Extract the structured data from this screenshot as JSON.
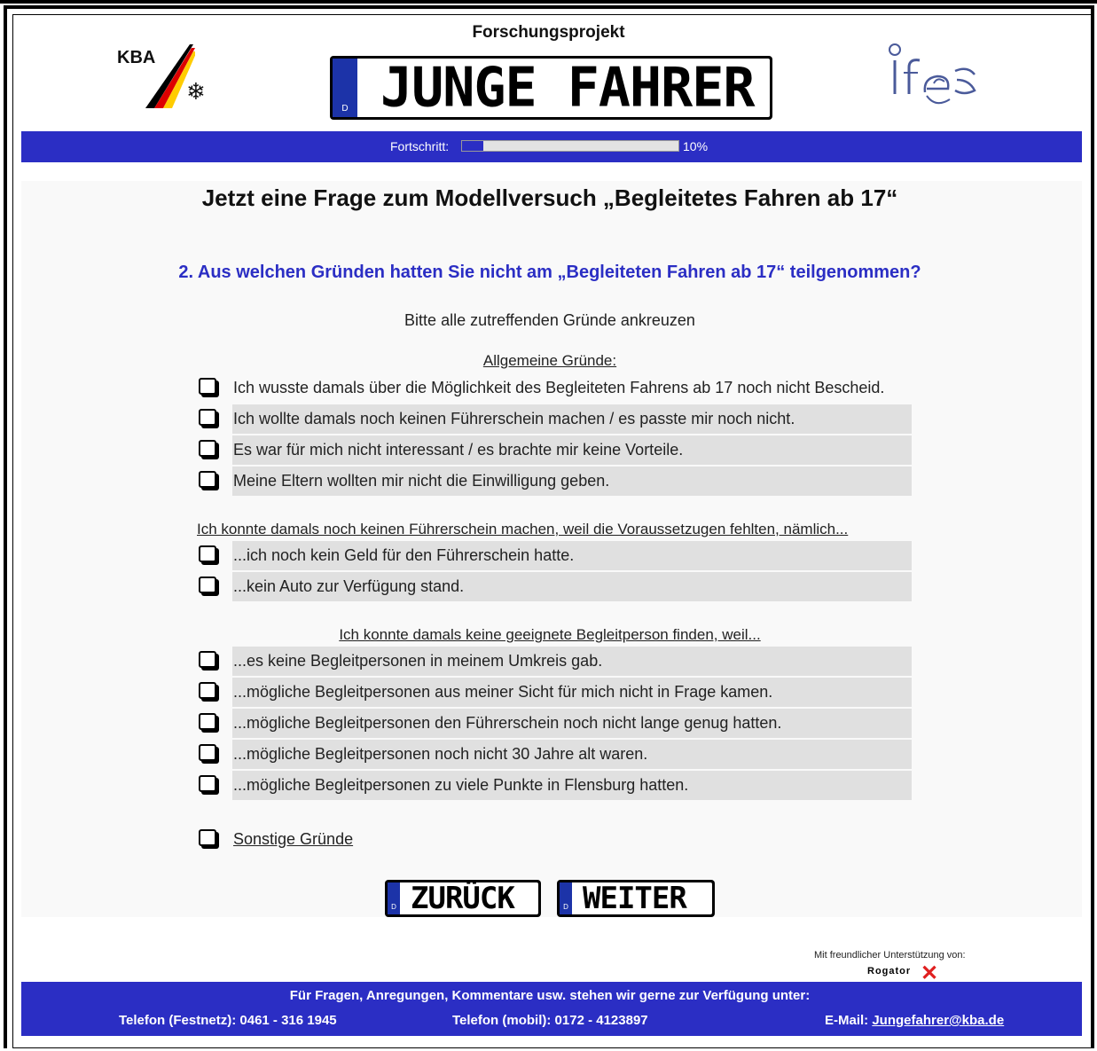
{
  "header": {
    "kba_label": "KBA",
    "project_title": "Forschungsprojekt",
    "plate_text": "JUNGE FAHRER",
    "plate_country": "D"
  },
  "progress": {
    "label": "Fortschritt:",
    "value_percent": 10,
    "value_text": "10%"
  },
  "main": {
    "headline": "Jetzt eine Frage zum Modellversuch „Begleitetes Fahren ab 17“",
    "question": "2. Aus welchen Gründen hatten Sie nicht am „Begleiteten Fahren ab 17“ teilgenommen?",
    "instruction": "Bitte alle zutreffenden Gründe ankreuzen",
    "sections": [
      {
        "title": "Allgemeine Gründe:",
        "options": [
          "Ich wusste damals über die Möglichkeit des Begleiteten Fahrens ab 17 noch nicht Bescheid.",
          "Ich wollte damals noch keinen Führerschein machen / es passte mir noch nicht.",
          "Es war für mich nicht interessant / es brachte mir keine Vorteile.",
          "Meine Eltern wollten mir nicht die Einwilligung geben."
        ]
      },
      {
        "title": "Ich konnte damals noch keinen Führerschein machen, weil die Voraussetzugen fehlten, nämlich...",
        "options": [
          "...ich noch kein Geld für den Führerschein hatte.",
          "...kein Auto zur Verfügung stand."
        ]
      },
      {
        "title": "Ich konnte damals keine geeignete Begleitperson finden, weil...",
        "options": [
          "...es keine Begleitpersonen in meinem Umkreis gab.",
          "...mögliche Begleitpersonen aus meiner Sicht für mich nicht in Frage kamen.",
          "...mögliche Begleitpersonen den Führerschein noch nicht lange genug hatten.",
          "...mögliche Begleitpersonen noch nicht 30 Jahre alt waren.",
          "...mögliche Begleitpersonen zu viele Punkte in Flensburg hatten."
        ]
      }
    ],
    "other_label": "Sonstige Gründe"
  },
  "nav": {
    "back_label": "ZURÜCK",
    "next_label": "WEITER"
  },
  "support": {
    "text": "Mit freundlicher Unterstützung von:",
    "brand": "Rogator"
  },
  "footer": {
    "line1": "Für Fragen, Anregungen, Kommentare usw. stehen wir gerne zur Verfügung unter:",
    "phone_landline": "Telefon (Festnetz): 0461 - 316 1945",
    "phone_mobile": "Telefon (mobil): 0172 - 4123897",
    "email_label": "E-Mail:",
    "email": "Jungefahrer@kba.de"
  },
  "colors": {
    "brand_blue": "#2b2ec4",
    "row_shade": "#e0e0e0"
  }
}
